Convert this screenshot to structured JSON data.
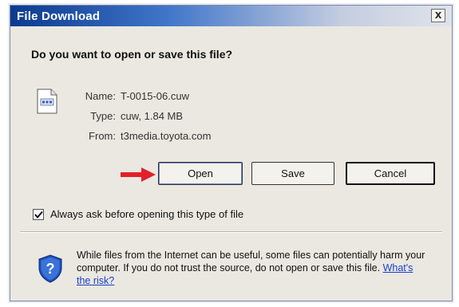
{
  "window": {
    "title": "File Download",
    "close_label": "x"
  },
  "dialog": {
    "question": "Do you want to open or save this file?",
    "file": {
      "name_label": "Name:",
      "name_value": "T-0015-06.cuw",
      "type_label": "Type:",
      "type_value": "cuw, 1.84 MB",
      "from_label": "From:",
      "from_value": "t3media.toyota.com"
    },
    "buttons": {
      "open": "Open",
      "save": "Save",
      "cancel": "Cancel"
    },
    "checkbox": {
      "label": "Always ask before opening this type of file",
      "checked": true
    },
    "warning": {
      "text": "While files from the Internet can be useful, some files can potentially harm your computer. If you do not trust the source, do not open or save this file. ",
      "link": "What's the risk?"
    }
  },
  "icons": {
    "file": "file-icon",
    "arrow": "red-arrow-icon",
    "shield": "security-shield-icon",
    "close": "close-icon",
    "check": "checkmark-icon"
  },
  "colors": {
    "title_bar_start": "#0c3a8f",
    "title_bar_end": "#dfe3ea",
    "arrow": "#e2202a",
    "shield": "#1e4fb8",
    "link": "#1a3fd0"
  }
}
